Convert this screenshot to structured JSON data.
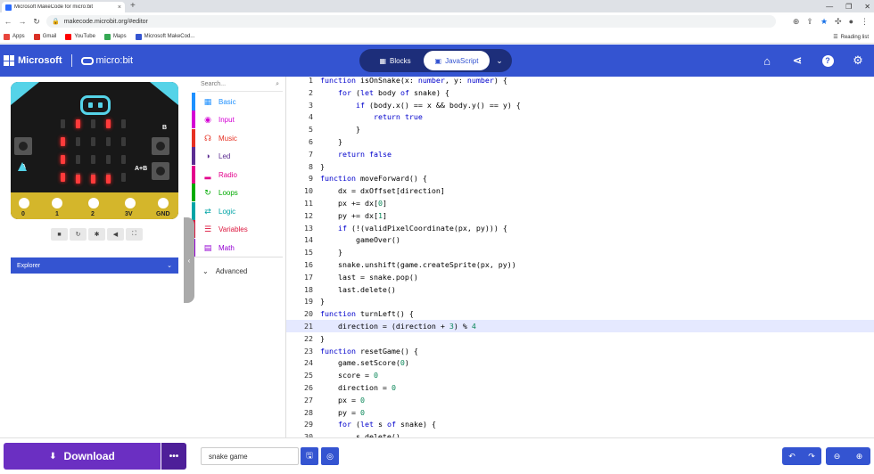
{
  "browser": {
    "tab_title": "Microsoft MakeCode for micro:bit",
    "url": "makecode.microbit.org/#editor",
    "bookmarks": [
      {
        "label": "Apps",
        "color": "#e8453c"
      },
      {
        "label": "Gmail",
        "color": "#d93025"
      },
      {
        "label": "YouTube",
        "color": "#ff0000"
      },
      {
        "label": "Maps",
        "color": "#34a853"
      },
      {
        "label": "Microsoft MakeCod...",
        "color": "#3454d1"
      }
    ],
    "reading_list": "Reading list"
  },
  "header": {
    "brand": "Microsoft",
    "product": "micro:bit",
    "mode_blocks": "Blocks",
    "mode_js": "JavaScript"
  },
  "simulator": {
    "button_a": "A",
    "button_b": "B",
    "button_ab": "A+B",
    "pins": [
      "0",
      "1",
      "2",
      "3V",
      "GND"
    ],
    "explorer": "Explorer"
  },
  "toolbox": {
    "search_placeholder": "Search...",
    "categories": [
      {
        "label": "Basic",
        "color": "#1e90ff"
      },
      {
        "label": "Input",
        "color": "#d400d4"
      },
      {
        "label": "Music",
        "color": "#e63022"
      },
      {
        "label": "Led",
        "color": "#5c2d91"
      },
      {
        "label": "Radio",
        "color": "#e3008c"
      },
      {
        "label": "Loops",
        "color": "#00aa00"
      },
      {
        "label": "Logic",
        "color": "#00a4a6"
      },
      {
        "label": "Variables",
        "color": "#dc143c"
      },
      {
        "label": "Math",
        "color": "#9400d3"
      }
    ],
    "advanced": "Advanced"
  },
  "editor": {
    "current_line": 21,
    "lines": [
      "function isOnSnake(x: number, y: number) {",
      "    for (let body of snake) {",
      "        if (body.x() == x && body.y() == y) {",
      "            return true",
      "        }",
      "    }",
      "    return false",
      "}",
      "function moveForward() {",
      "    dx = dxOffset[direction]",
      "    px += dx[0]",
      "    py += dx[1]",
      "    if (!(validPixelCoordinate(px, py))) {",
      "        gameOver()",
      "    }",
      "    snake.unshift(game.createSprite(px, py))",
      "    last = snake.pop()",
      "    last.delete()",
      "}",
      "function turnLeft() {",
      "    direction = (direction + 3) % 4",
      "}",
      "function resetGame() {",
      "    game.setScore(0)",
      "    score = 0",
      "    direction = 0",
      "    px = 0",
      "    py = 0",
      "    for (let s of snake) {",
      "        s.delete()"
    ]
  },
  "bottom": {
    "download": "Download",
    "project_name": "snake game"
  }
}
